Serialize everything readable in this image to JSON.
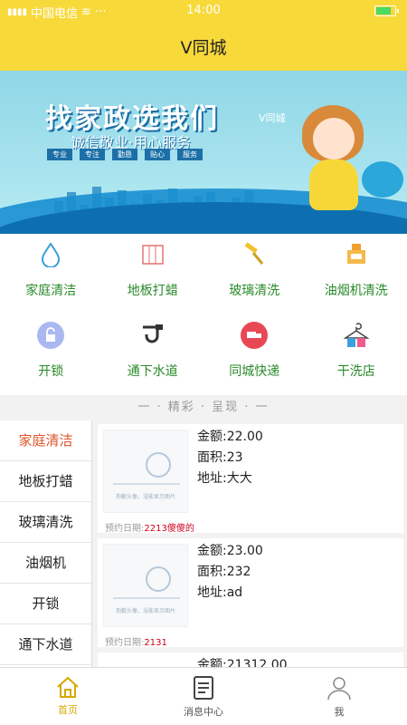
{
  "status": {
    "carrier": "中国电信",
    "time": "14:00"
  },
  "header": {
    "title": "V同城"
  },
  "banner": {
    "headline": "找家政选我们",
    "slogan": "诚信敬业·用心服务",
    "brand": "V同城",
    "tags": [
      "专业",
      "专注",
      "勤恳",
      "贴心",
      "服务"
    ]
  },
  "categories": [
    {
      "label": "家庭清洁",
      "icon": "water-drop-icon"
    },
    {
      "label": "地板打蜡",
      "icon": "floor-icon"
    },
    {
      "label": "玻璃清洗",
      "icon": "squeegee-icon"
    },
    {
      "label": "油烟机清洗",
      "icon": "range-hood-icon"
    },
    {
      "label": "开锁",
      "icon": "lock-icon"
    },
    {
      "label": "通下水道",
      "icon": "pipe-icon"
    },
    {
      "label": "同城快递",
      "icon": "truck-icon"
    },
    {
      "label": "干洗店",
      "icon": "hanger-icon"
    }
  ],
  "section_title": "一 · 精彩 · 呈现 · 一",
  "sidebar": {
    "items": [
      {
        "label": "家庭清洁"
      },
      {
        "label": "地板打蜡"
      },
      {
        "label": "玻璃清洗"
      },
      {
        "label": "油烟机"
      },
      {
        "label": "开锁"
      },
      {
        "label": "通下水道"
      }
    ],
    "active_index": 0
  },
  "orders": [
    {
      "amount": "金额:22.00",
      "area": "面积:23",
      "address": "地址:大大",
      "date_label": "预约日期:",
      "date_value": "2213傻傻的",
      "placeholder_caption": "抱歉头像，没能显示图片"
    },
    {
      "amount": "金额:23.00",
      "area": "面积:232",
      "address": "地址:ad",
      "date_label": "预约日期:",
      "date_value": "2131",
      "placeholder_caption": "抱歉头像，没能显示图片"
    },
    {
      "amount": "金额:21312.00"
    }
  ],
  "tabbar": {
    "items": [
      {
        "label": "首页",
        "icon": "home-icon"
      },
      {
        "label": "消息中心",
        "icon": "message-icon"
      },
      {
        "label": "我",
        "icon": "profile-icon"
      }
    ],
    "active_index": 0
  },
  "colors": {
    "header": "#f8d93a",
    "category_text": "#2a8a2a",
    "sidebar_active": "#e0542a",
    "date_value": "#d0021b",
    "tab_active": "#d6a800"
  }
}
